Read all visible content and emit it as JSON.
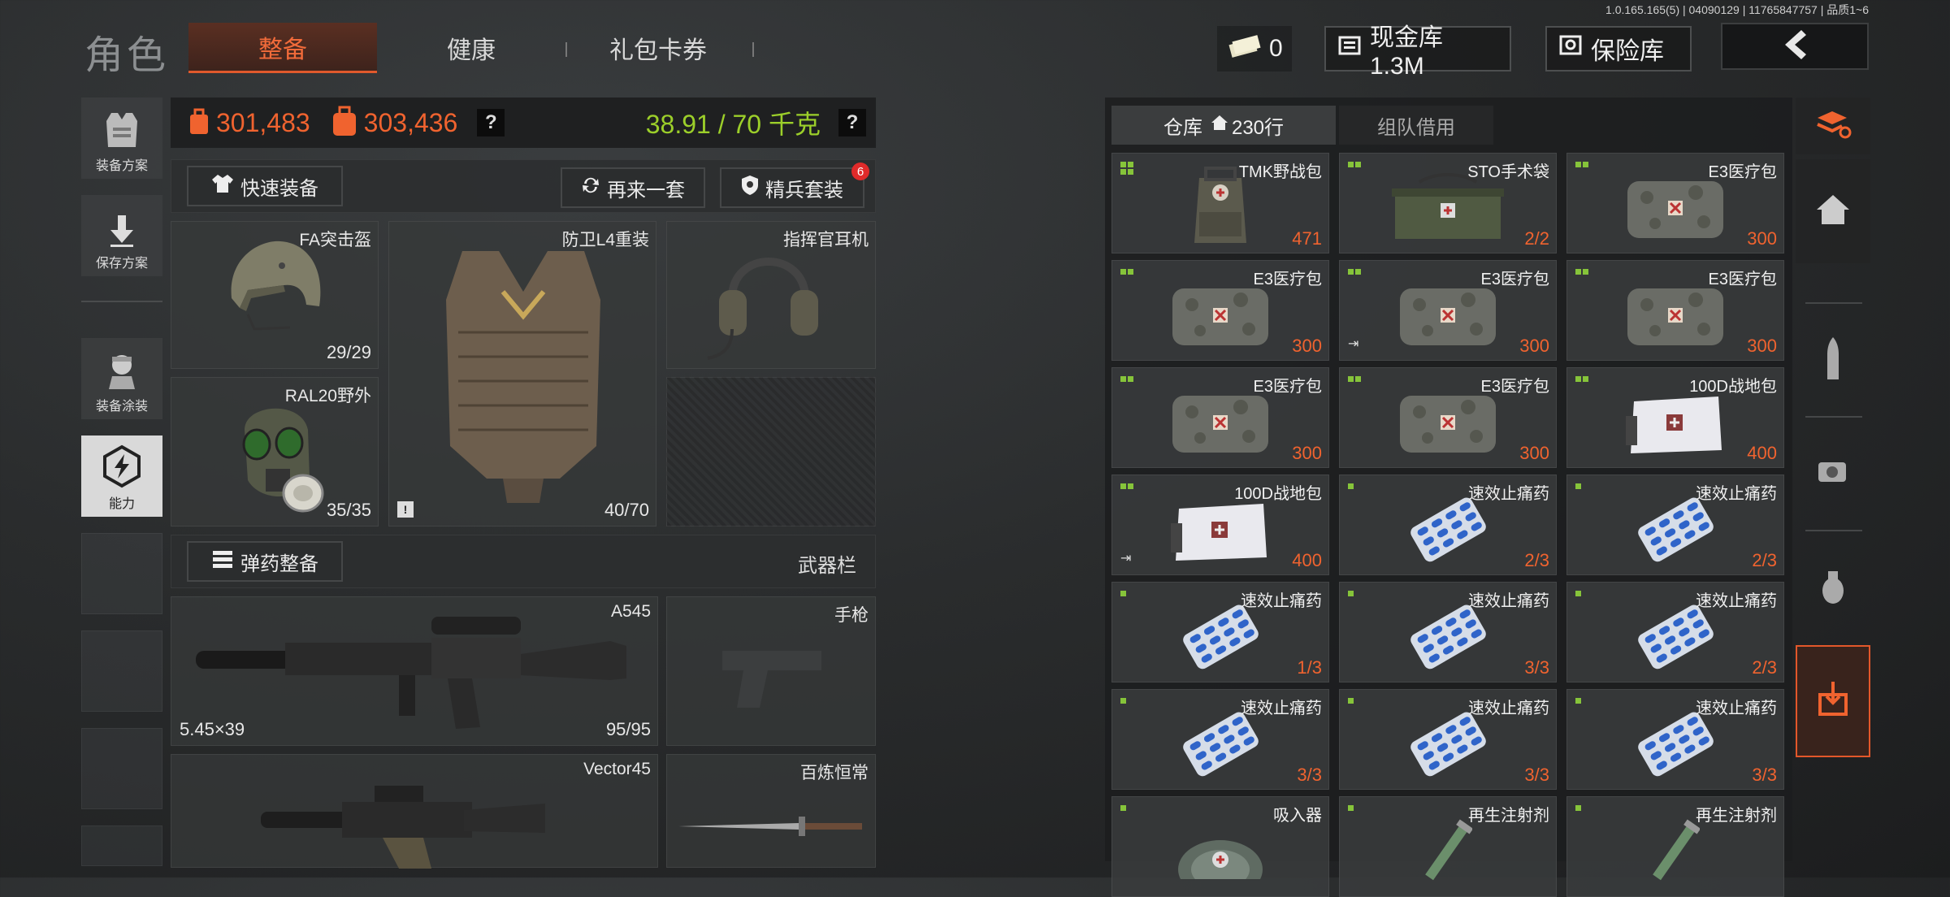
{
  "version": "1.0.165.165(5) | 04090129 | 11765847757 | 品质1~6",
  "header": {
    "title": "角色",
    "tabs": [
      "整备",
      "健康",
      "礼包卡券"
    ],
    "cash_count": "0",
    "cash_bank": "现金库 1.3M",
    "insurance": "保险库"
  },
  "sidebar": {
    "items": [
      "装备方案",
      "保存方案",
      "装备涂装",
      "能力"
    ]
  },
  "stats": {
    "value1": "301,483",
    "value2": "303,436",
    "weight": "38.91 / 70 千克",
    "help": "?"
  },
  "equip_bar": {
    "quick": "快速装备",
    "again": "再来一套",
    "elite": "精兵套装",
    "elite_badge": "6"
  },
  "gear": {
    "helmet": {
      "name": "FA突击盔",
      "count": "29/29"
    },
    "armor": {
      "name": "防卫L4重装",
      "count": "40/70"
    },
    "headset": {
      "name": "指挥官耳机"
    },
    "mask": {
      "name": "RAL20野外",
      "count": "35/35"
    }
  },
  "ammo_bar": {
    "label": "弹药整备",
    "weapon_slot": "武器栏"
  },
  "weapons": {
    "primary": {
      "name": "A545",
      "caliber": "5.45×39",
      "count": "95/95"
    },
    "pistol": {
      "name": "手枪"
    },
    "secondary": {
      "name": "Vector45"
    },
    "melee": {
      "name": "百炼恒常"
    }
  },
  "warehouse": {
    "tab_label": "仓库",
    "tab_rows": "230行",
    "team_tab": "组队借用",
    "items": [
      {
        "name": "TMK野战包",
        "qty": "471",
        "mark": "four",
        "kind": "bag"
      },
      {
        "name": "STO手术袋",
        "qty": "2/2",
        "mark": "two",
        "kind": "pouch"
      },
      {
        "name": "E3医疗包",
        "qty": "300",
        "mark": "two",
        "kind": "medkit"
      },
      {
        "name": "E3医疗包",
        "qty": "300",
        "mark": "two",
        "kind": "medkit"
      },
      {
        "name": "E3医疗包",
        "qty": "300",
        "mark": "two",
        "kind": "medkit",
        "exit": true
      },
      {
        "name": "E3医疗包",
        "qty": "300",
        "mark": "two",
        "kind": "medkit"
      },
      {
        "name": "E3医疗包",
        "qty": "300",
        "mark": "two",
        "kind": "medkit"
      },
      {
        "name": "E3医疗包",
        "qty": "300",
        "mark": "two",
        "kind": "medkit"
      },
      {
        "name": "100D战地包",
        "qty": "400",
        "mark": "two",
        "kind": "white"
      },
      {
        "name": "100D战地包",
        "qty": "400",
        "mark": "two",
        "kind": "white",
        "exit": true
      },
      {
        "name": "速效止痛药",
        "qty": "2/3",
        "mark": "one",
        "kind": "pills"
      },
      {
        "name": "速效止痛药",
        "qty": "2/3",
        "mark": "one",
        "kind": "pills"
      },
      {
        "name": "速效止痛药",
        "qty": "1/3",
        "mark": "one",
        "kind": "pills"
      },
      {
        "name": "速效止痛药",
        "qty": "3/3",
        "mark": "one",
        "kind": "pills"
      },
      {
        "name": "速效止痛药",
        "qty": "2/3",
        "mark": "one",
        "kind": "pills"
      },
      {
        "name": "速效止痛药",
        "qty": "3/3",
        "mark": "one",
        "kind": "pills"
      },
      {
        "name": "速效止痛药",
        "qty": "3/3",
        "mark": "one",
        "kind": "pills"
      },
      {
        "name": "速效止痛药",
        "qty": "3/3",
        "mark": "one",
        "kind": "pills"
      },
      {
        "name": "吸入器",
        "qty": "",
        "mark": "one",
        "kind": "inhaler"
      },
      {
        "name": "再生注射剂",
        "qty": "",
        "mark": "one",
        "kind": "syringe"
      },
      {
        "name": "再生注射剂",
        "qty": "",
        "mark": "one",
        "kind": "syringe"
      }
    ]
  },
  "right_nav": [
    "layers-refresh-icon",
    "home-icon",
    "ammo-icon",
    "sight-icon",
    "grenade-icon",
    "warehouse-out-icon"
  ],
  "colors": {
    "accent": "#f0632f",
    "weight_green": "#9ccf2a",
    "mark_green": "#86c43a"
  }
}
